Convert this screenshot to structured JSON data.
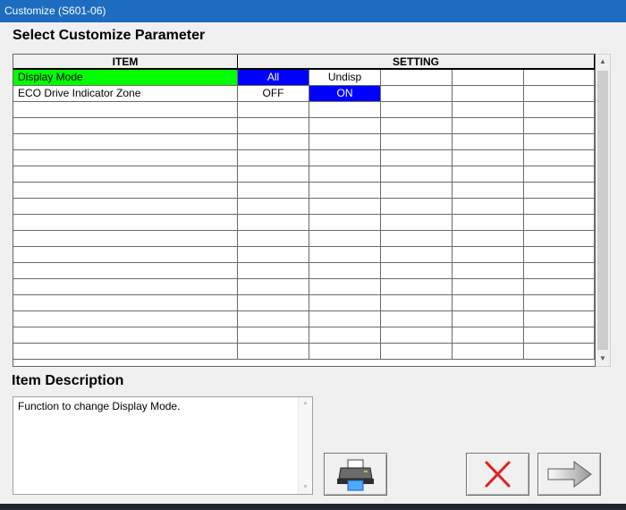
{
  "window": {
    "title": "Customize (S601-06)"
  },
  "headings": {
    "select": "Select Customize Parameter",
    "description": "Item Description"
  },
  "grid": {
    "columns": {
      "item": "ITEM",
      "setting": "SETTING"
    },
    "rows": [
      {
        "item": "Display Mode",
        "item_highlight": true,
        "settings": [
          "All",
          "Undisp",
          "",
          "",
          ""
        ],
        "selected_index": 0
      },
      {
        "item": "ECO Drive Indicator Zone",
        "item_highlight": false,
        "settings": [
          "OFF",
          "ON",
          "",
          "",
          ""
        ],
        "selected_index": 1
      }
    ],
    "empty_rows": 16
  },
  "description": {
    "text": "Function to change Display Mode."
  },
  "buttons": {
    "print_icon": "printer-icon",
    "cancel_icon": "red-x-icon",
    "next_icon": "arrow-right-icon"
  },
  "colors": {
    "titlebar": "#1c6dc0",
    "item_highlight": "#00ff00",
    "selection": "#0000ff",
    "cancel": "#e02020"
  }
}
